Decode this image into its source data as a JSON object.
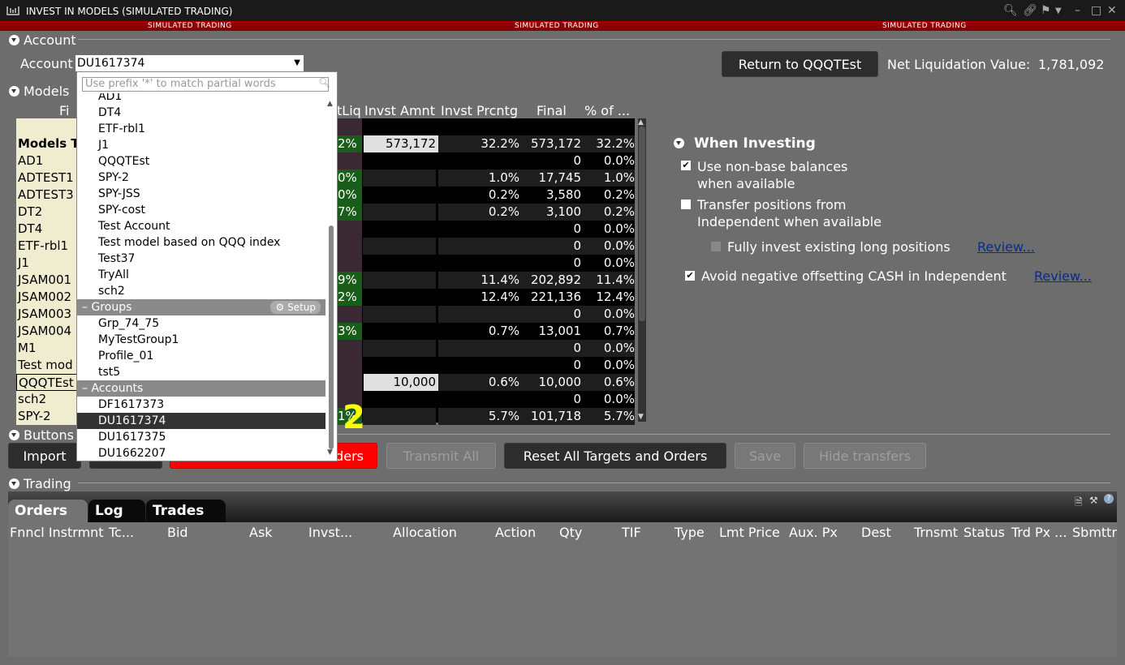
{
  "window": {
    "title": "INVEST IN MODELS (SIMULATED TRADING)",
    "sim_banner": "SIMULATED TRADING"
  },
  "account_section": {
    "header": "Account",
    "label": "Account",
    "selected_account": "DU1617374",
    "return_button": "Return to QQQTEst",
    "net_liq_label": "Net Liquidation Value:",
    "net_liq_value": "1,781,092"
  },
  "models_section": {
    "header": "Models",
    "columns": [
      "Fi",
      "tLiq",
      "Invst Amnt",
      "Invst Prcntg",
      "Final",
      "% of ..."
    ],
    "top_header": "Models T",
    "rows": [
      {
        "name": "",
        "pctliq": "",
        "amt": "",
        "prc": "",
        "final": "",
        "pct": ""
      },
      {
        "name": "Models T",
        "pctliq": "2%",
        "amt": "573,172",
        "prc": "32.2%",
        "final": "573,172",
        "pct": "32.2%",
        "green": true
      },
      {
        "name": "AD1",
        "pctliq": "",
        "amt": "",
        "prc": "",
        "final": "0",
        "pct": "0.0%"
      },
      {
        "name": "ADTEST1",
        "pctliq": "0%",
        "amt": "",
        "prc": "1.0%",
        "final": "17,745",
        "pct": "1.0%",
        "green": true
      },
      {
        "name": "ADTEST3",
        "pctliq": "0%",
        "amt": "",
        "prc": "0.2%",
        "final": "3,580",
        "pct": "0.2%",
        "green": true
      },
      {
        "name": "DT2",
        "pctliq": "7%",
        "amt": "",
        "prc": "0.2%",
        "final": "3,100",
        "pct": "0.2%",
        "green": true
      },
      {
        "name": "DT4",
        "pctliq": "",
        "amt": "",
        "prc": "",
        "final": "0",
        "pct": "0.0%"
      },
      {
        "name": "ETF-rbl1",
        "pctliq": "",
        "amt": "",
        "prc": "",
        "final": "0",
        "pct": "0.0%"
      },
      {
        "name": "J1",
        "pctliq": "",
        "amt": "",
        "prc": "",
        "final": "0",
        "pct": "0.0%"
      },
      {
        "name": "JSAM001",
        "pctliq": "9%",
        "amt": "",
        "prc": "11.4%",
        "final": "202,892",
        "pct": "11.4%",
        "green": true
      },
      {
        "name": "JSAM002",
        "pctliq": "2%",
        "amt": "",
        "prc": "12.4%",
        "final": "221,136",
        "pct": "12.4%",
        "green": true
      },
      {
        "name": "JSAM003",
        "pctliq": "",
        "amt": "",
        "prc": "",
        "final": "0",
        "pct": "0.0%"
      },
      {
        "name": "JSAM004",
        "pctliq": "3%",
        "amt": "",
        "prc": "0.7%",
        "final": "13,001",
        "pct": "0.7%",
        "green": true
      },
      {
        "name": "M1",
        "pctliq": "",
        "amt": "",
        "prc": "",
        "final": "0",
        "pct": "0.0%"
      },
      {
        "name": "Test mod",
        "pctliq": "",
        "amt": "",
        "prc": "",
        "final": "0",
        "pct": "0.0%"
      },
      {
        "name": "QQQTEst",
        "pctliq": "",
        "amt": "10,000",
        "prc": "0.6%",
        "final": "10,000",
        "pct": "0.6%"
      },
      {
        "name": "sch2",
        "pctliq": "",
        "amt": "",
        "prc": "",
        "final": "0",
        "pct": "0.0%"
      },
      {
        "name": "SPY-2",
        "pctliq": "1%",
        "amt": "",
        "prc": "5.7%",
        "final": "101,718",
        "pct": "5.7%",
        "green": true
      }
    ],
    "overlay_number": "2"
  },
  "when_investing": {
    "header": "When Investing",
    "opt1": "Use non-base balances",
    "opt1b": "when available",
    "opt2": "Transfer positions from",
    "opt2b": "Independent when available",
    "opt3": "Fully invest existing long positions",
    "opt4": "Avoid negative offsetting CASH in Independent",
    "review": "Review..."
  },
  "dropdown": {
    "placeholder": "Use prefix '*' to match partial words",
    "models": [
      "AD1",
      "DT4",
      "ETF-rbl1",
      "J1",
      "QQQTEst",
      "SPY-2",
      "SPY-JSS",
      "SPY-cost",
      "Test Account",
      "Test model based on QQQ index",
      "Test37",
      "TryAll",
      "sch2"
    ],
    "groups_label": "Groups",
    "setup_label": "Setup",
    "groups": [
      "Grp_74_75",
      "MyTestGroup1",
      "Profile_01",
      "tst5"
    ],
    "accounts_label": "Accounts",
    "accounts": [
      "DF1617373",
      "DU1617374",
      "DU1617375",
      "DU1662207"
    ]
  },
  "buttons_section": {
    "header": "Buttons",
    "import": "Import",
    "orders": "ders",
    "transmit_all": "Transmit All",
    "reset": "Reset All Targets and Orders",
    "save": "Save",
    "hide_transfers": "Hide transfers"
  },
  "trading_section": {
    "header": "Trading",
    "tabs": [
      "Orders",
      "Log",
      "Trades"
    ],
    "columns": [
      "Fnncl Instrmnt",
      "Tc...",
      "Bid",
      "Ask",
      "Invst...",
      "Allocation",
      "Action",
      "Qty",
      "TIF",
      "Type",
      "Lmt Price",
      "Aux. Px",
      "Dest",
      "Trnsmt",
      "Status",
      "Trd Px ...",
      "Sbmttr"
    ]
  }
}
